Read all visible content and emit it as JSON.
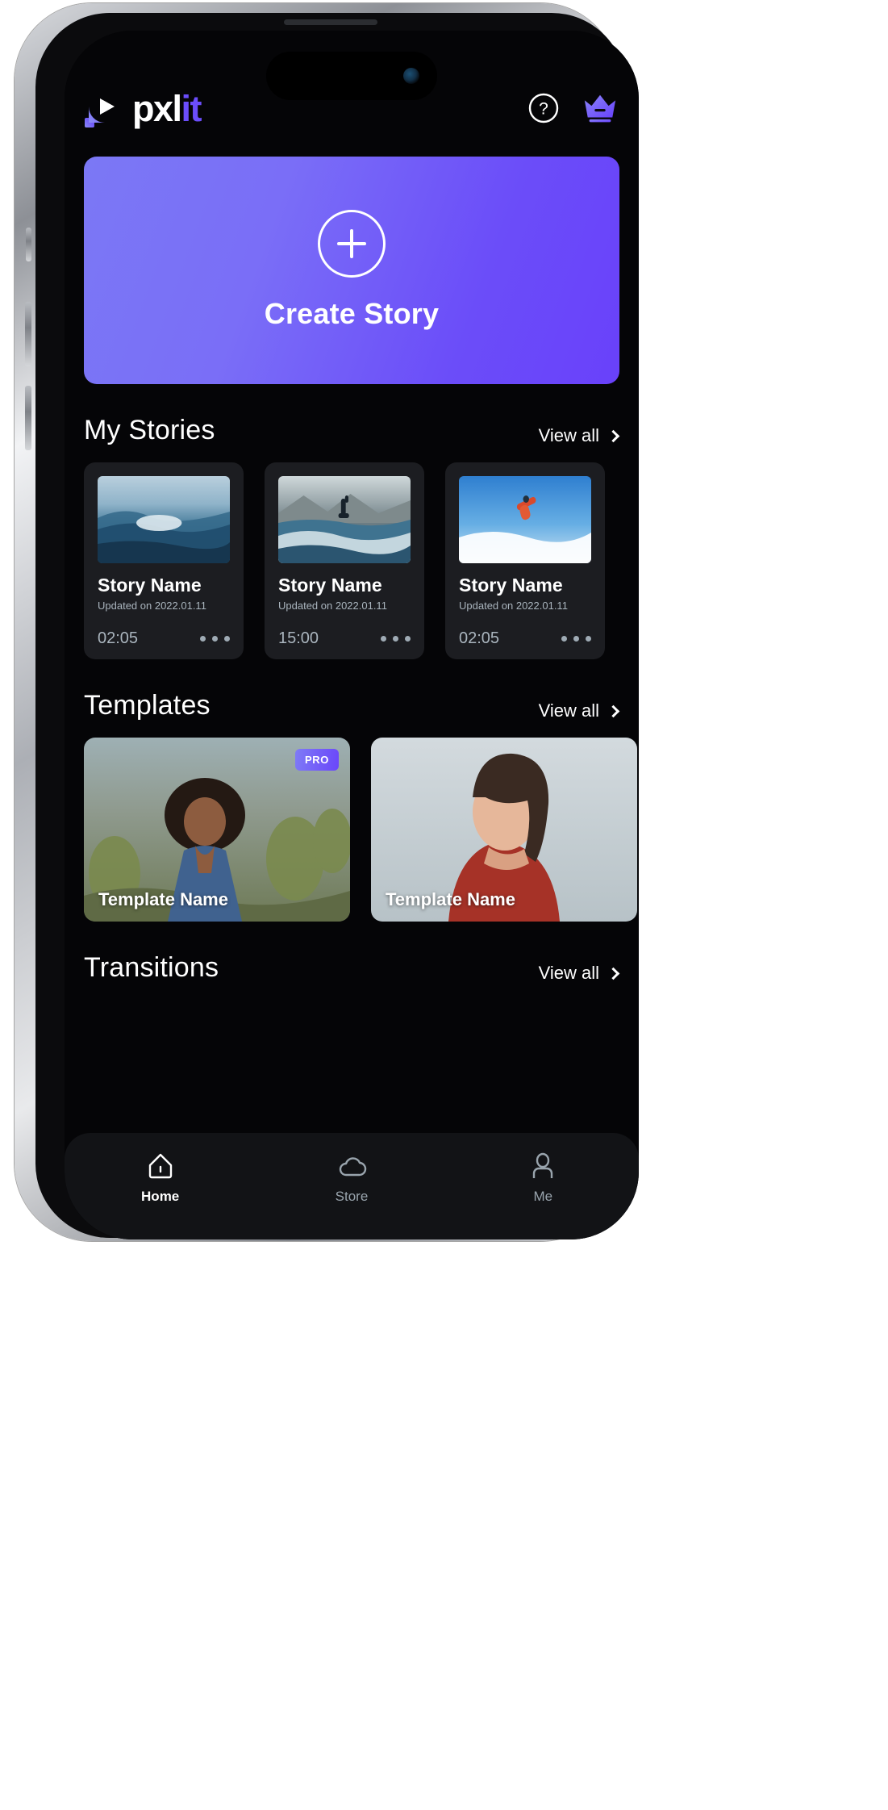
{
  "app": {
    "brand_white": "pxl",
    "brand_purple": "it",
    "accent": "#6B4DFB",
    "background": "#050507",
    "card_bg": "#1C1D21"
  },
  "appbar": {
    "help_icon": "question-circle-icon",
    "premium_icon": "crown-icon"
  },
  "hero": {
    "label": "Create Story",
    "icon": "plus-circle-icon"
  },
  "sections": [
    {
      "id": "my-stories",
      "title": "My Stories",
      "view_all": "View all",
      "chevron_icon": "chevron-right-icon"
    },
    {
      "id": "templates",
      "title": "Templates",
      "view_all": "View all",
      "chevron_icon": "chevron-right-icon"
    },
    {
      "id": "transitions",
      "title": "Transitions",
      "view_all": "View all",
      "chevron_icon": "chevron-right-icon"
    }
  ],
  "stories": [
    {
      "name": "Story Name",
      "updated": "Updated on 2022.01.11",
      "duration": "02:05",
      "menu_icon": "more-horizontal-icon",
      "thumb": "ocean-wave"
    },
    {
      "name": "Story Name",
      "updated": "Updated on 2022.01.11",
      "duration": "15:00",
      "menu_icon": "more-horizontal-icon",
      "thumb": "wakeboarder"
    },
    {
      "name": "Story Name",
      "updated": "Updated on 2022.01.11",
      "duration": "02:05",
      "menu_icon": "more-horizontal-icon",
      "thumb": "snowboarder"
    }
  ],
  "templates": [
    {
      "name": "Template Name",
      "badge": "PRO",
      "thumb": "woman-cactus"
    },
    {
      "name": "Template Name",
      "badge": "",
      "thumb": "woman-sky"
    }
  ],
  "bottom_nav": [
    {
      "label": "Home",
      "icon": "home-icon",
      "active": true
    },
    {
      "label": "Store",
      "icon": "cloud-icon",
      "active": false
    },
    {
      "label": "Me",
      "icon": "person-icon",
      "active": false
    }
  ]
}
